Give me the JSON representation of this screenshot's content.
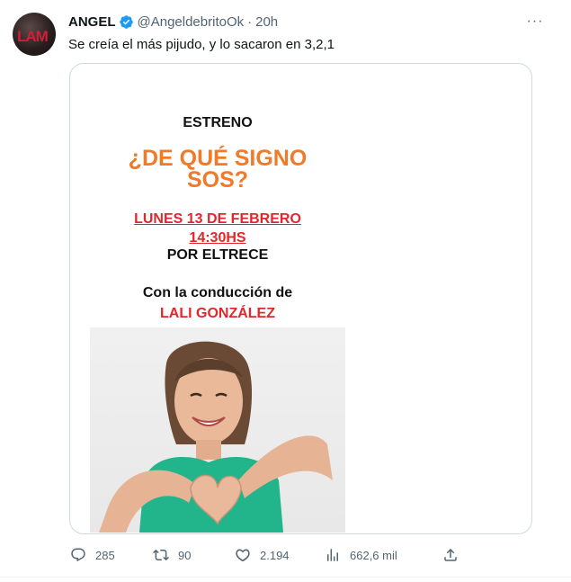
{
  "author": {
    "name": "ANGEL",
    "handle": "@AngeldebritoOk",
    "separator": "·",
    "time": "20h",
    "avatar_logo": "LAM"
  },
  "tweet_text": "Se creía el más pijudo, y lo sacaron en 3,2,1",
  "more_label": "···",
  "poster": {
    "estreno": "ESTRENO",
    "title_line1": "¿DE QUÉ SIGNO",
    "title_line2": "SOS?",
    "date": "LUNES 13 DE FEBRERO",
    "time": "14:30HS",
    "channel": "POR ELTRECE",
    "host_label": "Con la conducción de",
    "host_name": "LALI GONZÁLEZ"
  },
  "actions": {
    "replies": "285",
    "retweets": "90",
    "likes": "2.194",
    "views": "662,6 mil"
  },
  "colors": {
    "verified": "#1d9bf0",
    "title_orange": "#f07a2a",
    "accent_red": "#e3262b",
    "icon_gray": "#536471",
    "card_border": "#cfd9de"
  }
}
